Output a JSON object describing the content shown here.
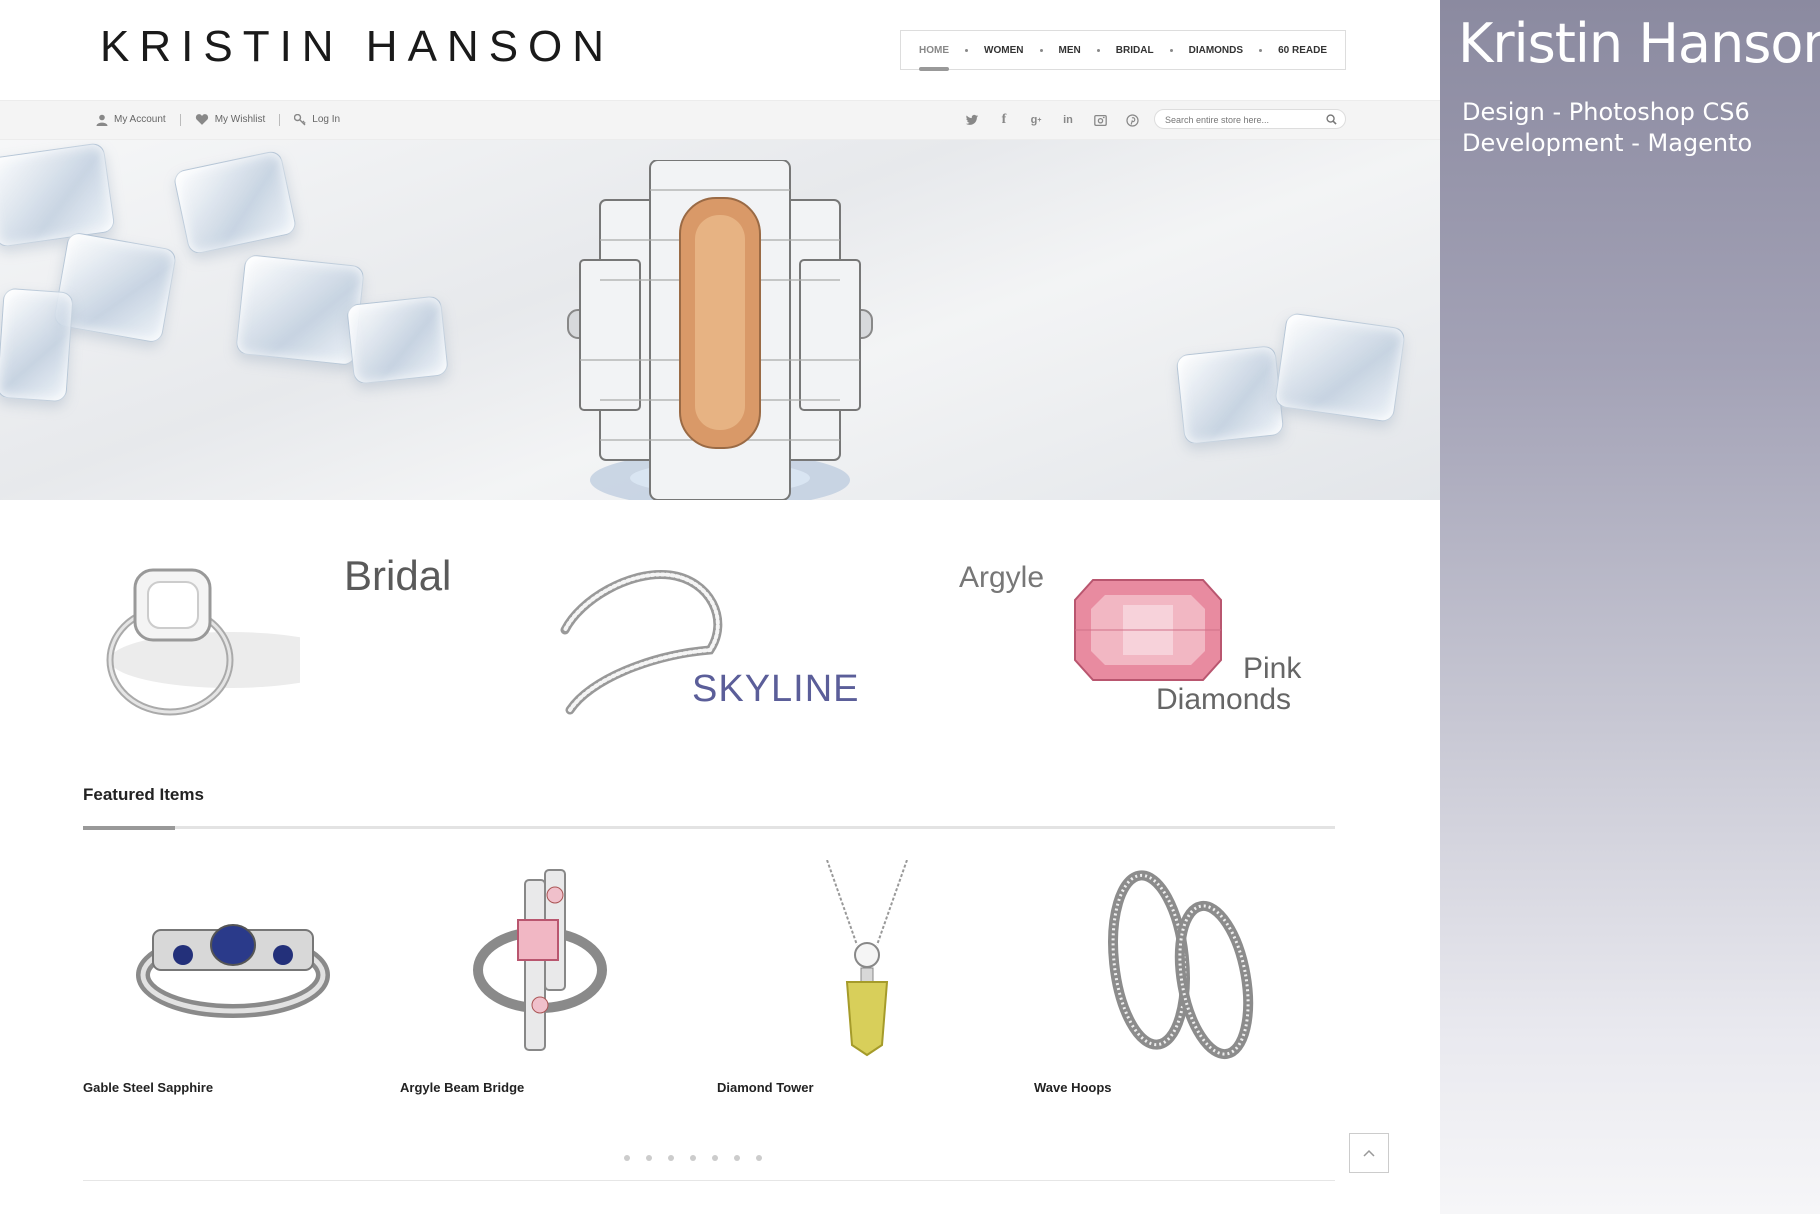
{
  "site": {
    "logo": "KRISTIN HANSON",
    "nav": [
      {
        "label": "HOME",
        "active": true
      },
      {
        "label": "WOMEN",
        "active": false
      },
      {
        "label": "MEN",
        "active": false
      },
      {
        "label": "BRIDAL",
        "active": false
      },
      {
        "label": "DIAMONDS",
        "active": false
      },
      {
        "label": "60 READE",
        "active": false
      }
    ],
    "account_links": {
      "my_account": "My Account",
      "my_wishlist": "My Wishlist",
      "log_in": "Log In"
    },
    "social_icons": [
      "twitter-icon",
      "facebook-icon",
      "google-plus-icon",
      "linkedin-icon",
      "instagram-icon",
      "pinterest-icon"
    ],
    "search": {
      "placeholder": "Search entire store here...",
      "value": ""
    }
  },
  "categories": {
    "bridal": "Bridal",
    "skyline": "SKYLINE",
    "argyle": "Argyle",
    "pink": "Pink",
    "diamonds": "Diamonds"
  },
  "featured": {
    "title": "Featured Items",
    "products": [
      {
        "name": "Gable Steel Sapphire"
      },
      {
        "name": "Argyle Beam Bridge"
      },
      {
        "name": "Diamond Tower"
      },
      {
        "name": "Wave Hoops"
      }
    ],
    "pager_count": 7
  },
  "info_panel": {
    "title": "Kristin Hanson",
    "design_line": "Design - Photoshop CS6",
    "development_line": "Development - Magento"
  },
  "colors": {
    "panel_top": "#8b8aa0",
    "skyline_accent": "#5b5e99",
    "pink_gem": "#e88ba0",
    "sapphire": "#2a3a8a",
    "citrine": "#d8cf5a"
  }
}
